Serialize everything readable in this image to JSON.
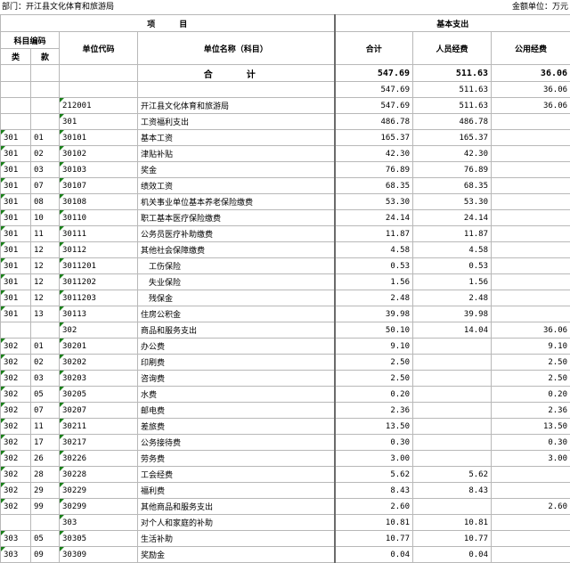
{
  "header": {
    "department": "部门：开江县文化体育和旅游局",
    "unit": "金额单位：万元"
  },
  "columns": {
    "item": "项　　　目",
    "basic": "基本支出",
    "subject_code": "科目编码",
    "lei": "类",
    "kuan": "款",
    "unit_code": "单位代码",
    "unit_name": "单位名称（科目）",
    "total": "合计",
    "personnel": "人员经费",
    "public": "公用经费"
  },
  "total_row": {
    "label": "合　计",
    "total": "547.69",
    "personnel": "511.63",
    "public": "36.06"
  },
  "rows": [
    {
      "lei": "",
      "kuan": "",
      "code": "",
      "name": "",
      "total": "547.69",
      "personnel": "511.63",
      "public": "36.06",
      "mark": false
    },
    {
      "lei": "",
      "kuan": "",
      "code": "212001",
      "name": "开江县文化体育和旅游局",
      "total": "547.69",
      "personnel": "511.63",
      "public": "36.06",
      "mark": true
    },
    {
      "lei": "",
      "kuan": "",
      "code": "301",
      "name": "工资福利支出",
      "total": "486.78",
      "personnel": "486.78",
      "public": "",
      "mark": true
    },
    {
      "lei": "301",
      "kuan": "01",
      "code": "30101",
      "name": "基本工资",
      "total": "165.37",
      "personnel": "165.37",
      "public": "",
      "mark": true
    },
    {
      "lei": "301",
      "kuan": "02",
      "code": "30102",
      "name": "津贴补贴",
      "total": "42.30",
      "personnel": "42.30",
      "public": "",
      "mark": true
    },
    {
      "lei": "301",
      "kuan": "03",
      "code": "30103",
      "name": "奖金",
      "total": "76.89",
      "personnel": "76.89",
      "public": "",
      "mark": true
    },
    {
      "lei": "301",
      "kuan": "07",
      "code": "30107",
      "name": "绩效工资",
      "total": "68.35",
      "personnel": "68.35",
      "public": "",
      "mark": true
    },
    {
      "lei": "301",
      "kuan": "08",
      "code": "30108",
      "name": "机关事业单位基本养老保险缴费",
      "total": "53.30",
      "personnel": "53.30",
      "public": "",
      "mark": true
    },
    {
      "lei": "301",
      "kuan": "10",
      "code": "30110",
      "name": "职工基本医疗保险缴费",
      "total": "24.14",
      "personnel": "24.14",
      "public": "",
      "mark": true
    },
    {
      "lei": "301",
      "kuan": "11",
      "code": "30111",
      "name": "公务员医疗补助缴费",
      "total": "11.87",
      "personnel": "11.87",
      "public": "",
      "mark": true
    },
    {
      "lei": "301",
      "kuan": "12",
      "code": "30112",
      "name": "其他社会保障缴费",
      "total": "4.58",
      "personnel": "4.58",
      "public": "",
      "mark": true
    },
    {
      "lei": "301",
      "kuan": "12",
      "code": "3011201",
      "name": "　工伤保险",
      "total": "0.53",
      "personnel": "0.53",
      "public": "",
      "mark": true
    },
    {
      "lei": "301",
      "kuan": "12",
      "code": "3011202",
      "name": "　失业保险",
      "total": "1.56",
      "personnel": "1.56",
      "public": "",
      "mark": true
    },
    {
      "lei": "301",
      "kuan": "12",
      "code": "3011203",
      "name": "　残保金",
      "total": "2.48",
      "personnel": "2.48",
      "public": "",
      "mark": true
    },
    {
      "lei": "301",
      "kuan": "13",
      "code": "30113",
      "name": "住房公积金",
      "total": "39.98",
      "personnel": "39.98",
      "public": "",
      "mark": true
    },
    {
      "lei": "",
      "kuan": "",
      "code": "302",
      "name": "商品和服务支出",
      "total": "50.10",
      "personnel": "14.04",
      "public": "36.06",
      "mark": true
    },
    {
      "lei": "302",
      "kuan": "01",
      "code": "30201",
      "name": "办公费",
      "total": "9.10",
      "personnel": "",
      "public": "9.10",
      "mark": true
    },
    {
      "lei": "302",
      "kuan": "02",
      "code": "30202",
      "name": "印刷费",
      "total": "2.50",
      "personnel": "",
      "public": "2.50",
      "mark": true
    },
    {
      "lei": "302",
      "kuan": "03",
      "code": "30203",
      "name": "咨询费",
      "total": "2.50",
      "personnel": "",
      "public": "2.50",
      "mark": true
    },
    {
      "lei": "302",
      "kuan": "05",
      "code": "30205",
      "name": "水费",
      "total": "0.20",
      "personnel": "",
      "public": "0.20",
      "mark": true
    },
    {
      "lei": "302",
      "kuan": "07",
      "code": "30207",
      "name": "邮电费",
      "total": "2.36",
      "personnel": "",
      "public": "2.36",
      "mark": true
    },
    {
      "lei": "302",
      "kuan": "11",
      "code": "30211",
      "name": "差旅费",
      "total": "13.50",
      "personnel": "",
      "public": "13.50",
      "mark": true
    },
    {
      "lei": "302",
      "kuan": "17",
      "code": "30217",
      "name": "公务接待费",
      "total": "0.30",
      "personnel": "",
      "public": "0.30",
      "mark": true
    },
    {
      "lei": "302",
      "kuan": "26",
      "code": "30226",
      "name": "劳务费",
      "total": "3.00",
      "personnel": "",
      "public": "3.00",
      "mark": true
    },
    {
      "lei": "302",
      "kuan": "28",
      "code": "30228",
      "name": "工会经费",
      "total": "5.62",
      "personnel": "5.62",
      "public": "",
      "mark": true
    },
    {
      "lei": "302",
      "kuan": "29",
      "code": "30229",
      "name": "福利费",
      "total": "8.43",
      "personnel": "8.43",
      "public": "",
      "mark": true
    },
    {
      "lei": "302",
      "kuan": "99",
      "code": "30299",
      "name": "其他商品和服务支出",
      "total": "2.60",
      "personnel": "",
      "public": "2.60",
      "mark": true
    },
    {
      "lei": "",
      "kuan": "",
      "code": "303",
      "name": "对个人和家庭的补助",
      "total": "10.81",
      "personnel": "10.81",
      "public": "",
      "mark": true
    },
    {
      "lei": "303",
      "kuan": "05",
      "code": "30305",
      "name": "生活补助",
      "total": "10.77",
      "personnel": "10.77",
      "public": "",
      "mark": true
    },
    {
      "lei": "303",
      "kuan": "09",
      "code": "30309",
      "name": "奖励金",
      "total": "0.04",
      "personnel": "0.04",
      "public": "",
      "mark": true
    }
  ]
}
